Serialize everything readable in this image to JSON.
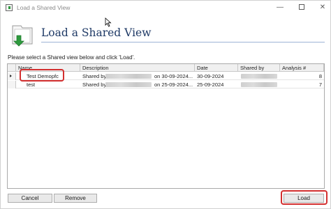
{
  "window": {
    "title": "Load a Shared View",
    "controls": {
      "minimize": "—",
      "close": "✕"
    }
  },
  "header": {
    "title": "Load a Shared View",
    "icon": "folder-download-icon"
  },
  "instruction": "Please select a Shared view below and click 'Load'.",
  "grid": {
    "columns": [
      "Name",
      "Description",
      "Date",
      "Shared by",
      "Analysis #"
    ],
    "rows": [
      {
        "name": "Test Demopfc",
        "description_prefix": "Shared by",
        "description_suffix": "on 30-09-2024...",
        "date": "30-09-2024",
        "analysis": "8",
        "selected": true
      },
      {
        "name": "test",
        "description_prefix": "Shared by",
        "description_suffix": "on 25-09-2024...",
        "date": "25-09-2024",
        "analysis": "7",
        "selected": false
      }
    ]
  },
  "buttons": {
    "cancel": "Cancel",
    "remove": "Remove",
    "load": "Load"
  },
  "colors": {
    "highlight": "#d32f2f",
    "header_title": "#1f3a66",
    "folder_arrow": "#2e9a3e"
  }
}
